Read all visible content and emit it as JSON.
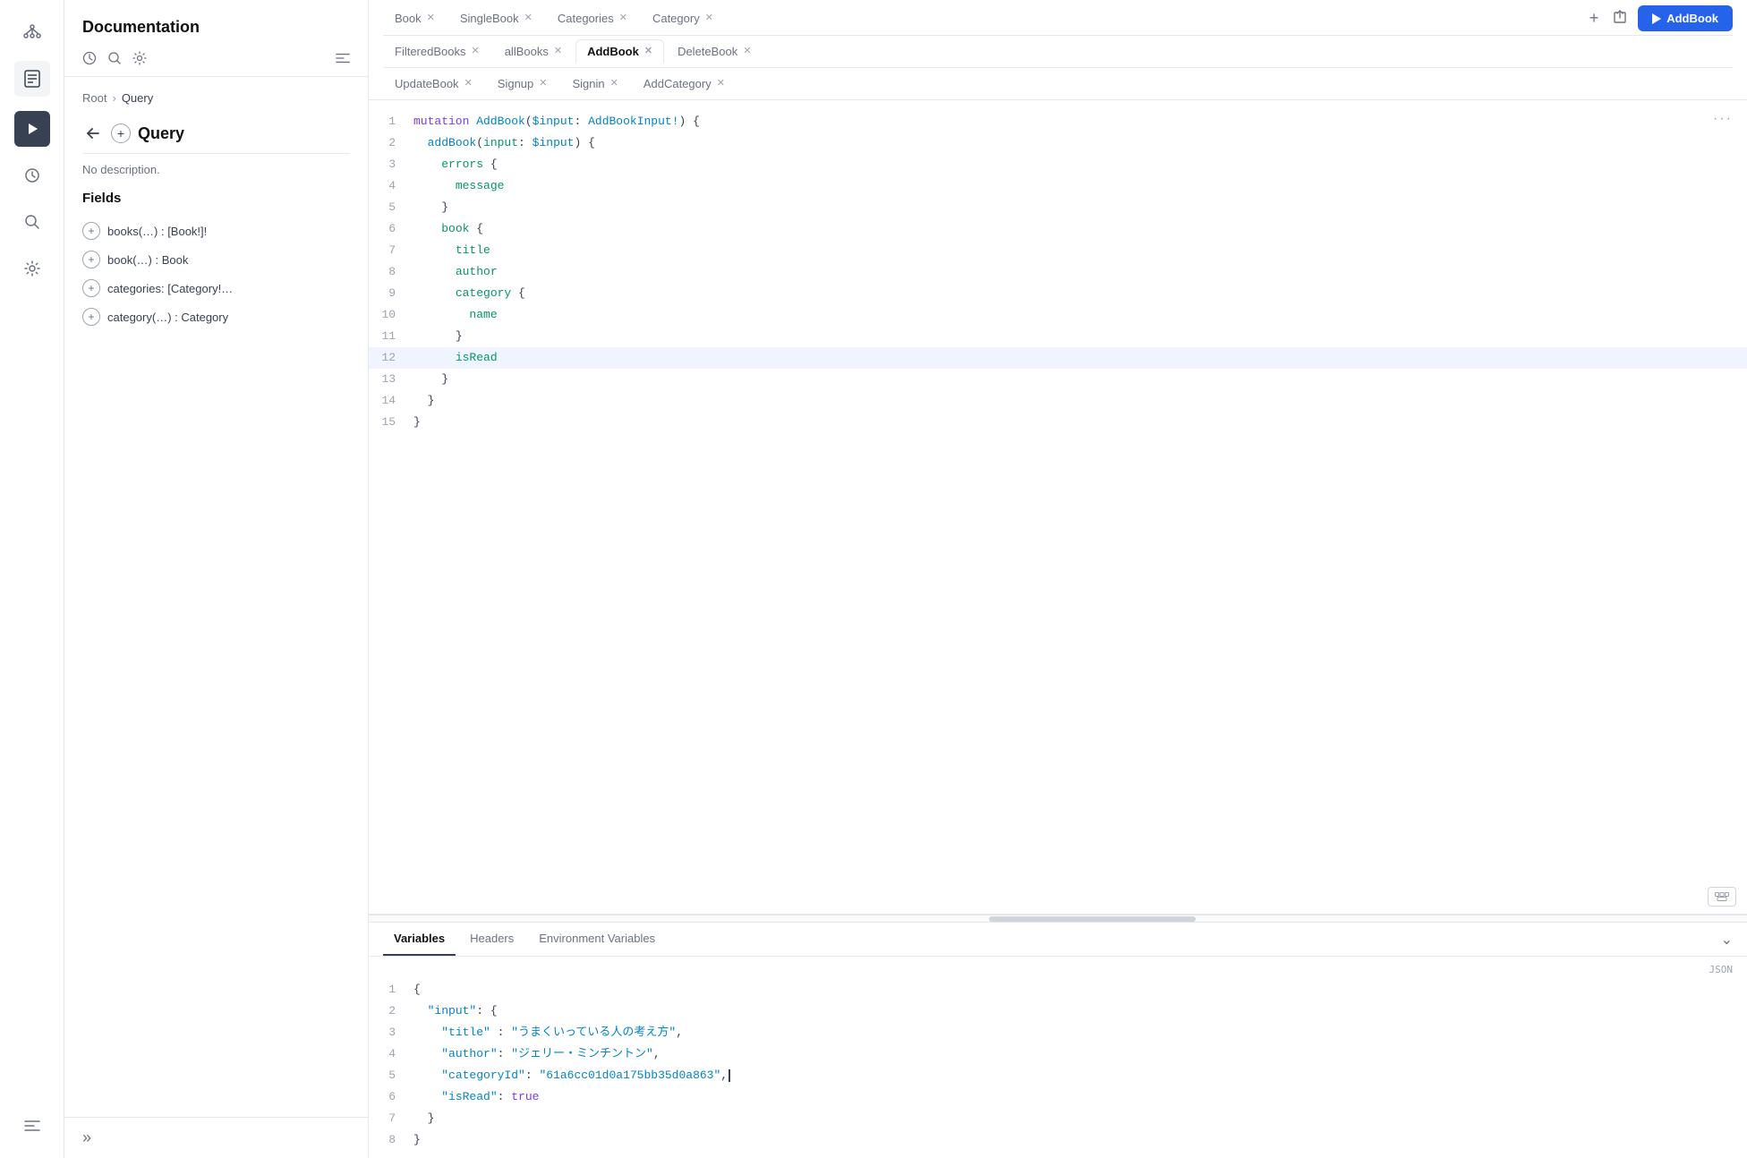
{
  "iconBar": {
    "graphIcon": "⊹",
    "docIcon": "📄",
    "historyIcon": "🕐",
    "searchIcon": "🔍",
    "settingsIcon": "⚙",
    "collapseIcon": "≪",
    "playIcon": "▶"
  },
  "sidebar": {
    "title": "Documentation",
    "breadcrumb": {
      "root": "Root",
      "separator": "›",
      "current": "Query"
    },
    "section": "Query",
    "noDescription": "No description.",
    "fields": {
      "label": "Fields",
      "items": [
        {
          "name": "books(...)",
          "type": "[Book!]!"
        },
        {
          "name": "book(...)",
          "type": "Book"
        },
        {
          "name": "categories:",
          "type": "[Category!..."
        },
        {
          "name": "category(...)",
          "type": "Category"
        }
      ]
    }
  },
  "tabs": {
    "row1": [
      {
        "label": "Book",
        "active": false
      },
      {
        "label": "SingleBook",
        "active": false
      },
      {
        "label": "Categories",
        "active": false
      },
      {
        "label": "Category",
        "active": false
      }
    ],
    "row2": [
      {
        "label": "FilteredBooks",
        "active": false
      },
      {
        "label": "allBooks",
        "active": false
      },
      {
        "label": "AddBook",
        "active": true
      },
      {
        "label": "DeleteBook",
        "active": false
      }
    ],
    "row3": [
      {
        "label": "UpdateBook",
        "active": false
      },
      {
        "label": "Signup",
        "active": false
      },
      {
        "label": "Signin",
        "active": false
      },
      {
        "label": "AddCategory",
        "active": false
      }
    ],
    "runButton": "AddBook"
  },
  "editor": {
    "lines": [
      {
        "num": 1,
        "content": "mutation AddBook($input: AddBookInput!) {"
      },
      {
        "num": 2,
        "content": "  addBook(input: $input) {"
      },
      {
        "num": 3,
        "content": "    errors {"
      },
      {
        "num": 4,
        "content": "      message"
      },
      {
        "num": 5,
        "content": "    }"
      },
      {
        "num": 6,
        "content": "    book {"
      },
      {
        "num": 7,
        "content": "      title"
      },
      {
        "num": 8,
        "content": "      author"
      },
      {
        "num": 9,
        "content": "      category {"
      },
      {
        "num": 10,
        "content": "        name"
      },
      {
        "num": 11,
        "content": "      }"
      },
      {
        "num": 12,
        "content": "      isRead",
        "highlighted": true
      },
      {
        "num": 13,
        "content": "    }"
      },
      {
        "num": 14,
        "content": "  }"
      },
      {
        "num": 15,
        "content": "}"
      }
    ],
    "moreLabel": "···"
  },
  "variables": {
    "tabs": [
      {
        "label": "Variables",
        "active": true
      },
      {
        "label": "Headers",
        "active": false
      },
      {
        "label": "Environment Variables",
        "active": false
      }
    ],
    "jsonLabel": "JSON",
    "collapseIcon": "⌄",
    "lines": [
      {
        "num": 1,
        "content": "{"
      },
      {
        "num": 2,
        "content": "  \"input\": {"
      },
      {
        "num": 3,
        "content": "    \"title\" : \"うまくいっている人の考え方\","
      },
      {
        "num": 4,
        "content": "    \"author\": \"ジェリー・ミンチントン\","
      },
      {
        "num": 5,
        "content": "    \"categoryId\": \"61a6cc01d0a175bb35d0a863\",",
        "cursor": true
      },
      {
        "num": 6,
        "content": "    \"isRead\": true"
      },
      {
        "num": 7,
        "content": "  }"
      },
      {
        "num": 8,
        "content": "}"
      }
    ]
  }
}
